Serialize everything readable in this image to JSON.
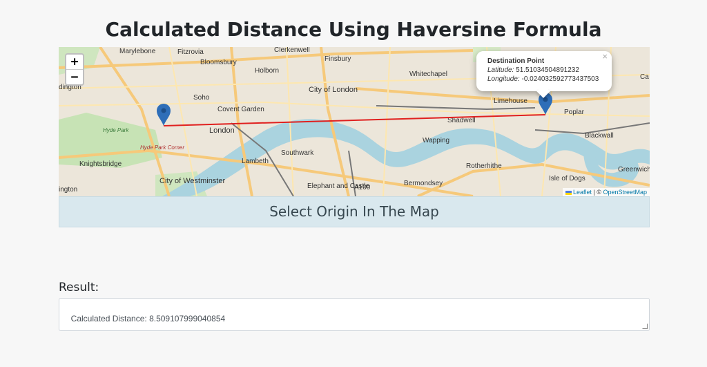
{
  "page": {
    "title": "Calculated Distance Using Haversine Formula"
  },
  "map": {
    "zoom_in_label": "+",
    "zoom_out_label": "−",
    "popup": {
      "title": "Destination Point",
      "latitude_label": "Latitude:",
      "latitude_value": "51.51034504891232",
      "longitude_label": "Longitude:",
      "longitude_value": "-0.024032592773437503",
      "close_label": "×"
    },
    "attribution": {
      "leaflet": "Leaflet",
      "separator": " | © ",
      "osm": "OpenStreetMap"
    },
    "route_color": "#e0201f",
    "marker_color": "#2e6eb8",
    "labels": [
      "Marylebone",
      "Fitzrovia",
      "Clerkenwell",
      "Finsbury",
      "Bloomsbury",
      "Holborn",
      "Whitechapel",
      "City of London",
      "Soho",
      "Covent Garden",
      "Limehouse",
      "Poplar",
      "London",
      "Shadwell",
      "Wapping",
      "Blackwall",
      "Hyde Park",
      "Hyde Park Corner",
      "Southwark",
      "Lambeth",
      "Knightsbridge",
      "Rotherhithe",
      "Greenwich Peninsula",
      "City of Westminster",
      "Elephant and Castle",
      "Bermondsey",
      "Isle of Dogs",
      "A100",
      "dington",
      "ington",
      "Ca"
    ]
  },
  "select_bar": {
    "label": "Select Origin In The Map"
  },
  "result": {
    "label": "Result:",
    "value": "Calculated Distance: 8.509107999040854"
  }
}
